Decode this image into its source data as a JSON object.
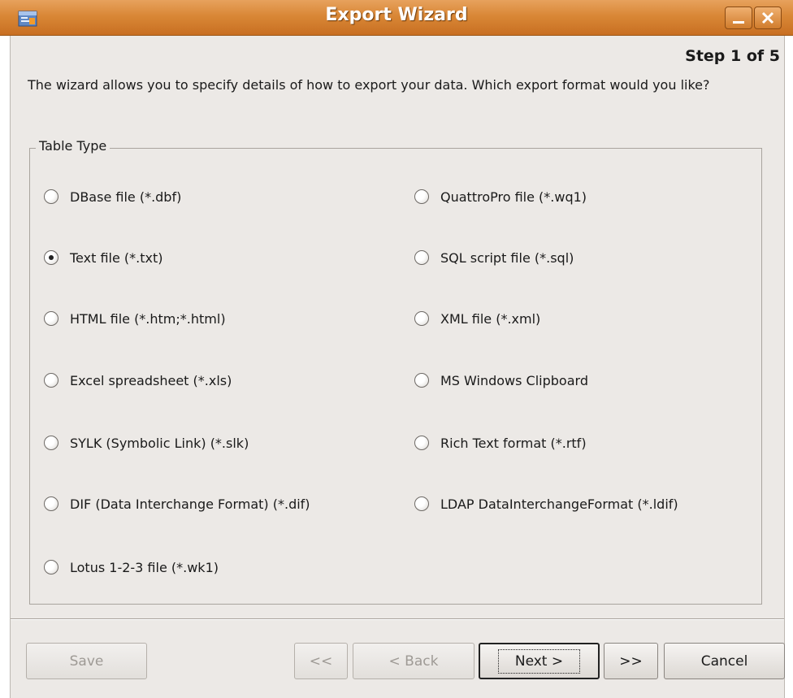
{
  "window": {
    "title": "Export Wizard",
    "minimize_icon": "minimize-icon",
    "close_icon": "close-icon"
  },
  "step": "Step 1 of 5",
  "description": "The wizard allows you to specify details of how to export your data. Which export format would you like?",
  "group": {
    "title": "Table Type",
    "options": [
      {
        "label": "DBase file (*.dbf)",
        "checked": false
      },
      {
        "label": "QuattroPro file (*.wq1)",
        "checked": false
      },
      {
        "label": "Text file (*.txt)",
        "checked": true
      },
      {
        "label": "SQL script file (*.sql)",
        "checked": false
      },
      {
        "label": "HTML file (*.htm;*.html)",
        "checked": false
      },
      {
        "label": "XML file (*.xml)",
        "checked": false
      },
      {
        "label": "Excel spreadsheet (*.xls)",
        "checked": false
      },
      {
        "label": "MS Windows Clipboard",
        "checked": false
      },
      {
        "label": "SYLK (Symbolic Link) (*.slk)",
        "checked": false
      },
      {
        "label": "Rich Text format (*.rtf)",
        "checked": false
      },
      {
        "label": "DIF (Data Interchange Format) (*.dif)",
        "checked": false
      },
      {
        "label": "LDAP DataInterchangeFormat (*.ldif)",
        "checked": false
      },
      {
        "label": "Lotus 1-2-3 file (*.wk1)",
        "checked": false
      }
    ]
  },
  "buttons": {
    "save": "Save",
    "first": "<<",
    "back": "< Back",
    "next": "Next >",
    "last": ">>",
    "cancel": "Cancel"
  },
  "colors": {
    "titlebar": "#d98736",
    "background": "#ece9e6"
  }
}
